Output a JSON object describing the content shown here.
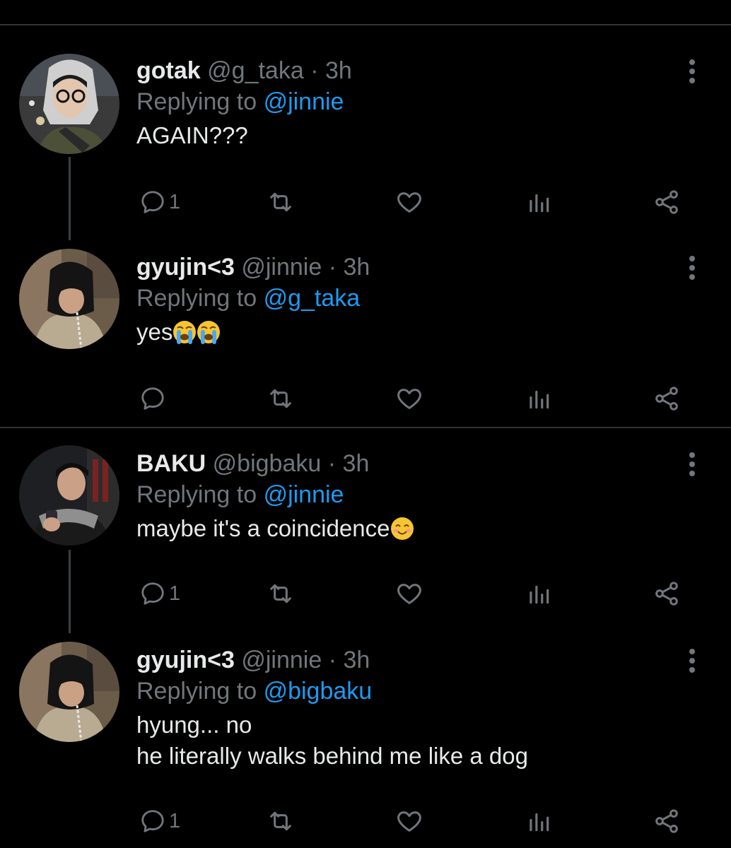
{
  "tweets": [
    {
      "name": "gotak",
      "handle": "@g_taka",
      "separator": "·",
      "time": "3h",
      "reply_prefix": "Replying to",
      "reply_to": "@jinnie",
      "lines": [
        "AGAIN???"
      ],
      "reply_count": "1"
    },
    {
      "name": "gyujin<3",
      "handle": "@jinnie",
      "separator": "·",
      "time": "3h",
      "reply_prefix": "Replying to",
      "reply_to": "@g_taka",
      "text": "yes",
      "emoji": [
        "loudly-crying-face",
        "loudly-crying-face"
      ],
      "reply_count": ""
    },
    {
      "name": "BAKU",
      "handle": "@bigbaku",
      "separator": "·",
      "time": "3h",
      "reply_prefix": "Replying to",
      "reply_to": "@jinnie",
      "text": "maybe it's a coincidence",
      "emoji": [
        "smiling-face-with-smiling-eyes"
      ],
      "reply_count": "1"
    },
    {
      "name": "gyujin<3",
      "handle": "@jinnie",
      "separator": "·",
      "time": "3h",
      "reply_prefix": "Replying to",
      "reply_to": "@bigbaku",
      "lines": [
        "hyung... no",
        "he literally walks behind me like a dog"
      ],
      "reply_count": "1"
    }
  ],
  "icons": {
    "reply": "reply-icon",
    "retweet": "retweet-icon",
    "like": "heart-icon",
    "views": "analytics-icon",
    "share": "share-icon",
    "more": "more-vertical-icon"
  },
  "colors": {
    "background": "#000000",
    "text": "#e7e9ea",
    "secondary": "#71767b",
    "mention": "#1d9bf0",
    "divider": "#2f3336"
  }
}
